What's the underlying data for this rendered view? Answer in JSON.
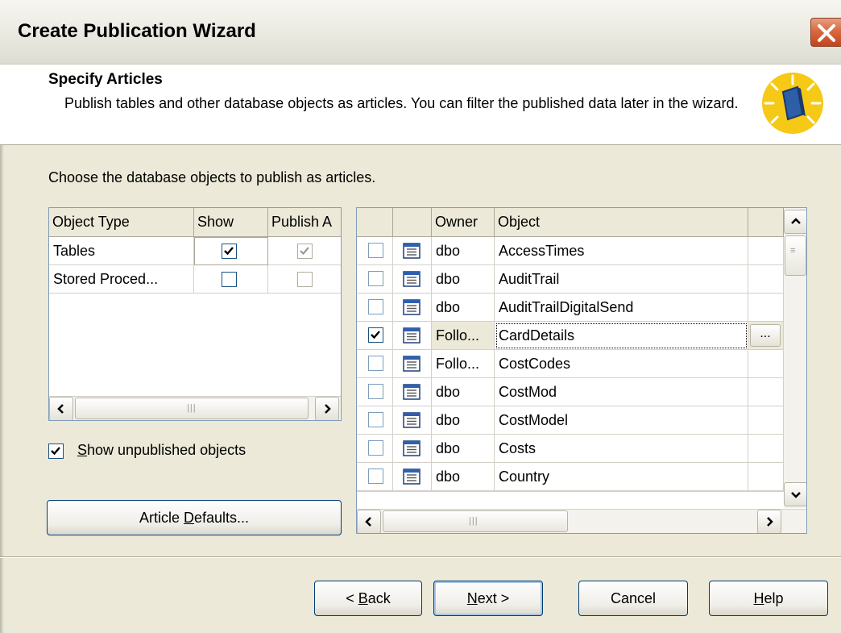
{
  "window": {
    "title": "Create Publication Wizard"
  },
  "header": {
    "title": "Specify Articles",
    "description": "Publish tables and other database objects as articles. You can filter the published data later in the wizard.",
    "icon": "wizard-book-icon"
  },
  "instruction": "Choose the database objects to publish as articles.",
  "object_types": {
    "columns": [
      "Object Type",
      "Show",
      "Publish A"
    ],
    "rows": [
      {
        "type": "Tables",
        "show": true,
        "publish": true
      },
      {
        "type": "Stored Proced...",
        "show": false,
        "publish": false
      }
    ]
  },
  "articles": {
    "columns": [
      "",
      "",
      "Owner",
      "Object",
      ""
    ],
    "rows": [
      {
        "checked": false,
        "owner": "dbo",
        "object": "AccessTimes"
      },
      {
        "checked": false,
        "owner": "dbo",
        "object": "AuditTrail"
      },
      {
        "checked": false,
        "owner": "dbo",
        "object": "AuditTrailDigitalSend"
      },
      {
        "checked": true,
        "owner": "Follo...",
        "object": "CardDetails",
        "ellipsis": "..."
      },
      {
        "checked": false,
        "owner": "Follo...",
        "object": "CostCodes"
      },
      {
        "checked": false,
        "owner": "dbo",
        "object": "CostMod"
      },
      {
        "checked": false,
        "owner": "dbo",
        "object": "CostModel"
      },
      {
        "checked": false,
        "owner": "dbo",
        "object": "Costs"
      },
      {
        "checked": false,
        "owner": "dbo",
        "object": "Country"
      }
    ]
  },
  "show_unpublished": {
    "checked": true,
    "label_pre": "",
    "label_accel": "S",
    "label_post": "how unpublished objects"
  },
  "buttons": {
    "article_defaults": {
      "pre": "Article ",
      "accel": "D",
      "post": "efaults..."
    },
    "back": {
      "pre": "< ",
      "accel": "B",
      "post": "ack"
    },
    "next": {
      "pre": "",
      "accel": "N",
      "post": "ext >"
    },
    "cancel": "Cancel",
    "help": {
      "pre": "",
      "accel": "H",
      "post": "elp"
    }
  },
  "colors": {
    "titlebar": "#ece9d8",
    "close": "#d9693f",
    "grid_border": "#7f9db9",
    "check": "#1c5180"
  }
}
